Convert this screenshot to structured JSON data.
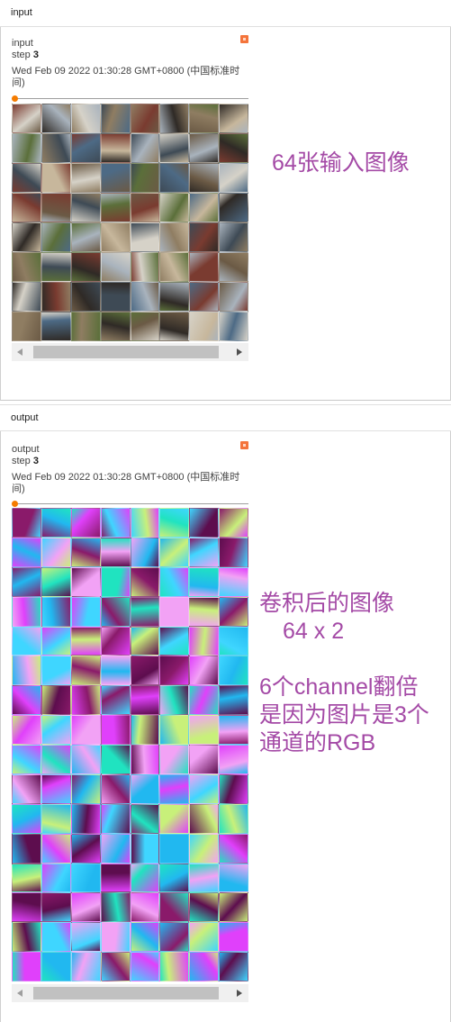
{
  "input_section": {
    "header": "input",
    "card": {
      "name": "input",
      "step_label": "step",
      "step_value": "3",
      "timestamp": "Wed Feb 09 2022 01:30:28 GMT+0800 (中国标准时间)"
    },
    "grid": {
      "rows": 8,
      "cols": 8,
      "kind": "natural-photos"
    },
    "annotation": "64张输入图像"
  },
  "output_section": {
    "header": "output",
    "card": {
      "name": "output",
      "step_label": "step",
      "step_value": "3",
      "timestamp": "Wed Feb 09 2022 01:30:28 GMT+0800 (中国标准时间)"
    },
    "grid": {
      "rows": 16,
      "cols": 8,
      "kind": "feature-maps"
    },
    "annotation_lines": [
      "卷积后的图像",
      "64 x 2",
      "",
      "6个channel翻倍",
      "是因为图片是3个",
      "通道的RGB"
    ]
  },
  "colors": {
    "accent_orange": "#f57c00",
    "expand_button": "#f4743b",
    "annotation": "#a44aa6",
    "feature_palette": [
      "#e040fb",
      "#5d0d4e",
      "#20e3c0",
      "#c8f07a",
      "#21b8f0",
      "#f2a2f5",
      "#8a1a6a",
      "#3fd6ff"
    ],
    "photo_palette": [
      "#6b5a45",
      "#8f7d62",
      "#3e4a55",
      "#a9b3bd",
      "#5b6f3a",
      "#2f2a26",
      "#c7b79c",
      "#4d6a85",
      "#7a3b30",
      "#d6d2c8"
    ]
  },
  "icons": {
    "expand": "expand-icon",
    "scroll_left": "chevron-left-icon",
    "scroll_right": "chevron-right-icon"
  }
}
